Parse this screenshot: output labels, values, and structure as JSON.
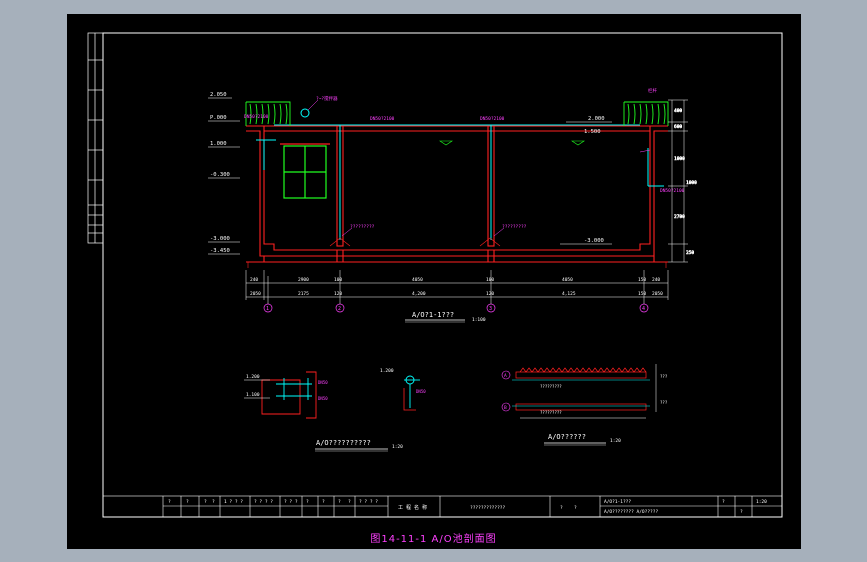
{
  "figure_caption": "图14-11-1 A/O池剖面图",
  "colors": {
    "outer_frame": "#000000",
    "drawing_bg": "#000000",
    "wall": "#ff2020",
    "pipe": "#00ffff",
    "fence": "#20ff20",
    "annotation": "#ff40ff",
    "dimension": "#ffffff",
    "caption": "#ff40ff"
  },
  "section": {
    "title": "A/O?1-1???",
    "scale": "1:100",
    "elevations_left": [
      "2.050",
      "P.000",
      "1.000",
      "-0.300",
      "-3.000",
      "-3.450"
    ],
    "elevations_right": [
      "2.000",
      "1.500",
      "-3.000"
    ],
    "pipe_labels": [
      "DN50?2100",
      "DN50?2100",
      "DN50?2100",
      "DN50?2100"
    ],
    "blower_label": "?~?搅拌器",
    "rail_label": "栏杆",
    "diffuser_labels": [
      "?????????",
      "?????????"
    ],
    "dims_row1": [
      "240",
      "2900",
      "100",
      "4050",
      "100",
      "4050",
      "150",
      "240"
    ],
    "dims_row2": [
      "2050",
      "2175",
      "120",
      "4,200",
      "120",
      "4,125",
      "150",
      "2050"
    ],
    "right_dims": [
      "400",
      "600",
      "1000",
      "2700",
      "1000",
      "250"
    ],
    "axes": [
      "1",
      "2",
      "3",
      "4"
    ]
  },
  "detail1": {
    "title": "A/O??????????",
    "scale": "1:20",
    "labels": [
      "1.200",
      "1.100",
      "DN50",
      "DN50"
    ]
  },
  "detail2": {
    "labels": [
      "1.200",
      "DN50"
    ]
  },
  "detail3": {
    "title": "A/O??????",
    "scale": "1:20",
    "labels": [
      "?????????",
      "?????????",
      "???",
      "???"
    ],
    "circle_labels": [
      "A",
      "B"
    ]
  },
  "title_block": {
    "cells": [
      "?",
      "?",
      "?",
      "?",
      "1 ? ? ?",
      "? ? ? ?",
      "? ? ?",
      "?",
      "?",
      "?",
      "?",
      "? ? ? ?"
    ],
    "project": "工 程 名 称",
    "project_name": "?????????????",
    "drawing_name_1": "A/O?1-1???",
    "drawing_name_2": "A/O???????? A/O?????",
    "sheet_cells": [
      "?",
      "?",
      "1:20",
      "?",
      "?"
    ]
  }
}
